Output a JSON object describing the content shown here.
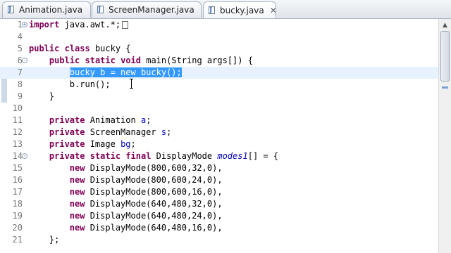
{
  "tabs": [
    {
      "label": "Animation.java",
      "active": false
    },
    {
      "label": "ScreenManager.java",
      "active": false
    },
    {
      "label": "bucky.java",
      "active": true,
      "close": "✕"
    }
  ],
  "icons": {
    "tab_file": "java-file-icon",
    "fold": "fold-toggle-icon"
  },
  "colors": {
    "keyword": "#7f0055",
    "field": "#0000c0",
    "selection": "#3399ff",
    "current_line": "#e8f2fe"
  },
  "editor": {
    "lines": [
      {
        "n": "1",
        "fold": "+",
        "tokens": [
          [
            "kw",
            "import"
          ],
          [
            "t",
            " java.awt.*;"
          ]
        ],
        "box": true
      },
      {
        "n": "4",
        "tokens": []
      },
      {
        "n": "5",
        "tokens": [
          [
            "kw",
            "public"
          ],
          [
            "t",
            " "
          ],
          [
            "kw",
            "class"
          ],
          [
            "t",
            " bucky {"
          ]
        ]
      },
      {
        "n": "6",
        "fold": "-",
        "tokens": [
          [
            "t",
            "    "
          ],
          [
            "kw",
            "public"
          ],
          [
            "t",
            " "
          ],
          [
            "kw",
            "static"
          ],
          [
            "t",
            " "
          ],
          [
            "kw",
            "void"
          ],
          [
            "t",
            " main(String args[]) {"
          ]
        ]
      },
      {
        "n": "7",
        "current": true,
        "tokens": [
          [
            "t",
            "        "
          ],
          [
            "sel",
            "bucky b = new bucky();"
          ]
        ]
      },
      {
        "n": "8",
        "tokens": [
          [
            "t",
            "        b.run();"
          ]
        ]
      },
      {
        "n": "9",
        "tokens": [
          [
            "t",
            "    }"
          ]
        ]
      },
      {
        "n": "10",
        "tokens": []
      },
      {
        "n": "11",
        "tokens": [
          [
            "t",
            "    "
          ],
          [
            "kw",
            "private"
          ],
          [
            "t",
            " Animation "
          ],
          [
            "fld",
            "a"
          ],
          [
            "t",
            ";"
          ]
        ]
      },
      {
        "n": "12",
        "tokens": [
          [
            "t",
            "    "
          ],
          [
            "kw",
            "private"
          ],
          [
            "t",
            " ScreenManager "
          ],
          [
            "fld",
            "s"
          ],
          [
            "t",
            ";"
          ]
        ]
      },
      {
        "n": "13",
        "tokens": [
          [
            "t",
            "    "
          ],
          [
            "kw",
            "private"
          ],
          [
            "t",
            " Image "
          ],
          [
            "fld",
            "bg"
          ],
          [
            "t",
            ";"
          ]
        ]
      },
      {
        "n": "14",
        "fold": "-",
        "tokens": [
          [
            "t",
            "    "
          ],
          [
            "kw",
            "private"
          ],
          [
            "t",
            " "
          ],
          [
            "kw",
            "static"
          ],
          [
            "t",
            " "
          ],
          [
            "kw",
            "final"
          ],
          [
            "t",
            " DisplayMode "
          ],
          [
            "it",
            "modes1"
          ],
          [
            "t",
            "[] = {"
          ]
        ]
      },
      {
        "n": "15",
        "tokens": [
          [
            "t",
            "        "
          ],
          [
            "kw",
            "new"
          ],
          [
            "t",
            " DisplayMode(800,600,32,0),"
          ]
        ]
      },
      {
        "n": "16",
        "tokens": [
          [
            "t",
            "        "
          ],
          [
            "kw",
            "new"
          ],
          [
            "t",
            " DisplayMode(800,600,24,0),"
          ]
        ]
      },
      {
        "n": "17",
        "tokens": [
          [
            "t",
            "        "
          ],
          [
            "kw",
            "new"
          ],
          [
            "t",
            " DisplayMode(800,600,16,0),"
          ]
        ]
      },
      {
        "n": "18",
        "tokens": [
          [
            "t",
            "        "
          ],
          [
            "kw",
            "new"
          ],
          [
            "t",
            " DisplayMode(640,480,32,0),"
          ]
        ]
      },
      {
        "n": "19",
        "tokens": [
          [
            "t",
            "        "
          ],
          [
            "kw",
            "new"
          ],
          [
            "t",
            " DisplayMode(640,480,24,0),"
          ]
        ]
      },
      {
        "n": "20",
        "tokens": [
          [
            "t",
            "        "
          ],
          [
            "kw",
            "new"
          ],
          [
            "t",
            " DisplayMode(640,480,16,0),"
          ]
        ]
      },
      {
        "n": "21",
        "tokens": [
          [
            "t",
            "    };"
          ]
        ]
      }
    ]
  }
}
